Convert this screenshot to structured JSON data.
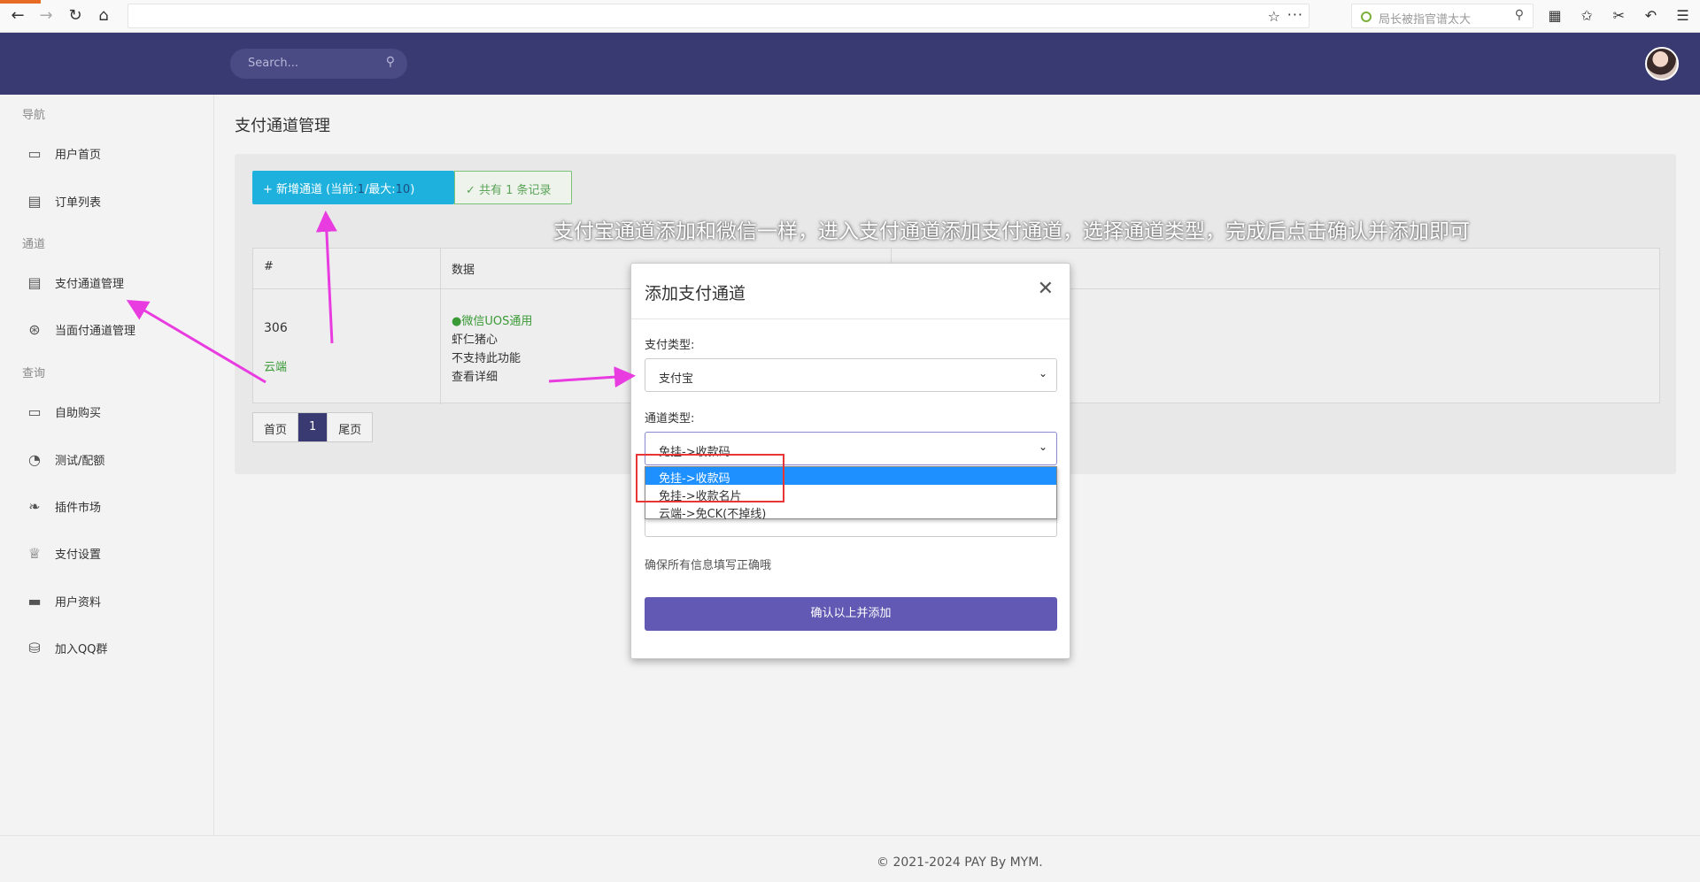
{
  "browser": {
    "search_placeholder": "局长被指官谱太大"
  },
  "header": {
    "search_placeholder": "Search..."
  },
  "sidebar": {
    "sections": [
      "导航",
      "通道",
      "查询"
    ],
    "items": [
      {
        "label": "用户首页",
        "icon": "monitor-icon"
      },
      {
        "label": "订单列表",
        "icon": "clipboard-icon"
      },
      {
        "label": "支付通道管理",
        "icon": "clipboard-icon"
      },
      {
        "label": "当面付通道管理",
        "icon": "lifebuoy-icon"
      },
      {
        "label": "自助购买",
        "icon": "monitor-icon"
      },
      {
        "label": "测试/配额",
        "icon": "pie-chart-icon"
      },
      {
        "label": "插件市场",
        "icon": "leaf-icon"
      },
      {
        "label": "支付设置",
        "icon": "trophy-icon"
      },
      {
        "label": "用户资料",
        "icon": "card-icon"
      },
      {
        "label": "加入QQ群",
        "icon": "database-icon"
      }
    ]
  },
  "main": {
    "page_title": "支付通道管理",
    "add_button": {
      "prefix": "+ 新增通道 (当前:",
      "current": "1",
      "mid": "/最大:",
      "max": "10",
      "suffix": ")"
    },
    "count_badge": "✓ 共有 1 条记录",
    "table": {
      "headers": [
        "#",
        "数据"
      ],
      "row": {
        "id": "306",
        "mode": "云端",
        "channel_name": "微信UOS通用",
        "owner": "虾仁猪心",
        "note": "不支持此功能",
        "detail_link": "查看详细"
      }
    },
    "pager": [
      "首页",
      "1",
      "尾页"
    ]
  },
  "annotation": {
    "text": "支付宝通道添加和微信一样，进入支付通道添加支付通道，选择通道类型，完成后点击确认并添加即可"
  },
  "modal": {
    "title": "添加支付通道",
    "pay_type_label": "支付类型:",
    "pay_type_value": "支付宝",
    "channel_type_label": "通道类型:",
    "channel_type_value": "免挂->收款码",
    "channel_options": [
      "免挂->收款码",
      "免挂->收款名片",
      "云端->免CK(不掉线)"
    ],
    "hint": "确保所有信息填写正确哦",
    "submit_label": "确认以上并添加"
  },
  "footer": {
    "copyright": "© 2021-2024 PAY By MYM."
  },
  "colors": {
    "header_bg": "#3a3a73",
    "add_button_bg": "#1eb1de",
    "submit_bg": "#6159b3",
    "highlight_box": "#e83535",
    "arrow": "#e83be0",
    "selected_option": "#1e90ff"
  }
}
